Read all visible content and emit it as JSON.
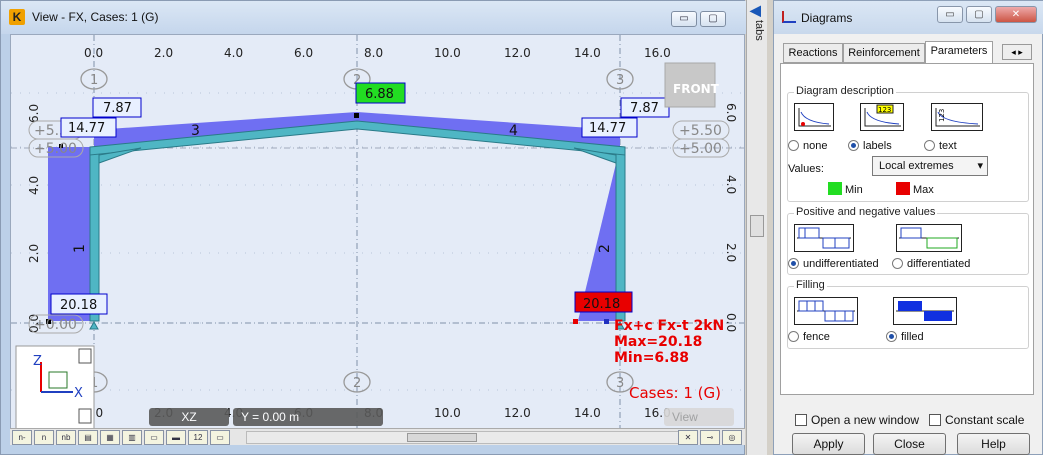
{
  "view_window": {
    "title": "View - FX, Cases: 1 (G)",
    "app_icon": "K",
    "controls": {
      "minimize": "▭",
      "restore": "▢",
      "close": "✕"
    }
  },
  "canvas": {
    "top_ruler": [
      "0.0",
      "2.0",
      "4.0",
      "6.0",
      "8.0",
      "10.0",
      "12.0",
      "14.0",
      "16.0"
    ],
    "bottom_ruler": [
      "0.0",
      "2.0",
      "4.0",
      "6.0",
      "8.0",
      "10.0",
      "12.0",
      "14.0",
      "16.0"
    ],
    "left_ruler": [
      "6.0",
      "4.0",
      "2.0",
      "0.0"
    ],
    "right_ruler": [
      "6.0",
      "4.0",
      "2.0",
      "0.0"
    ],
    "node_circles": [
      "1",
      "2",
      "3"
    ],
    "level_labels": [
      "+5.50",
      "+5.00",
      "+0.00"
    ],
    "right_level_labels": [
      "+5.50",
      "+5.00"
    ],
    "bar_labels": [
      "1",
      "2",
      "3",
      "4"
    ],
    "value_labels": {
      "left_top_a": "7.87",
      "left_top_b": "14.77",
      "right_top_a": "7.87",
      "right_top_b": "14.77",
      "ridge": "6.88",
      "left_base": "20.18",
      "right_base": "20.18"
    },
    "legend_text": [
      "Fx+c Fx-t 2kN",
      "Max=20.18",
      "Min=6.88"
    ],
    "cases_text": "Cases: 1 (G)",
    "front_cube": "FRONT",
    "axis_labels": {
      "z": "Z",
      "x": "X"
    },
    "colors": {
      "diagram_fill": "#6f6ff2",
      "member": "#4fb6c4",
      "min_label": "#22dd22",
      "max_label": "#e80000",
      "label_box": "#0000cc"
    }
  },
  "status": {
    "plane": "XZ",
    "coord": "Y = 0.00 m",
    "view": "View"
  },
  "vscroll": {
    "tabs_label": "tabs"
  },
  "diagrams": {
    "title": "Diagrams",
    "tabs": [
      "Reactions",
      "Reinforcement",
      "Parameters"
    ],
    "active_tab": "Parameters",
    "description": {
      "label": "Diagram description",
      "options": [
        "none",
        "labels",
        "text"
      ],
      "selected": "labels",
      "pic2_text": "123",
      "pic3_text": "123",
      "values_label": "Values:",
      "values_select": "Local extremes",
      "min_label": "Min",
      "max_label": "Max"
    },
    "posneg": {
      "label": "Positive and negative values",
      "options": [
        "undifferentiated",
        "differentiated"
      ],
      "selected": "undifferentiated"
    },
    "filling": {
      "label": "Filling",
      "options": [
        "fence",
        "filled"
      ],
      "selected": "filled"
    },
    "checkboxes": [
      "Open a new window",
      "Constant scale"
    ],
    "buttons": [
      "Apply",
      "Close",
      "Help"
    ]
  }
}
